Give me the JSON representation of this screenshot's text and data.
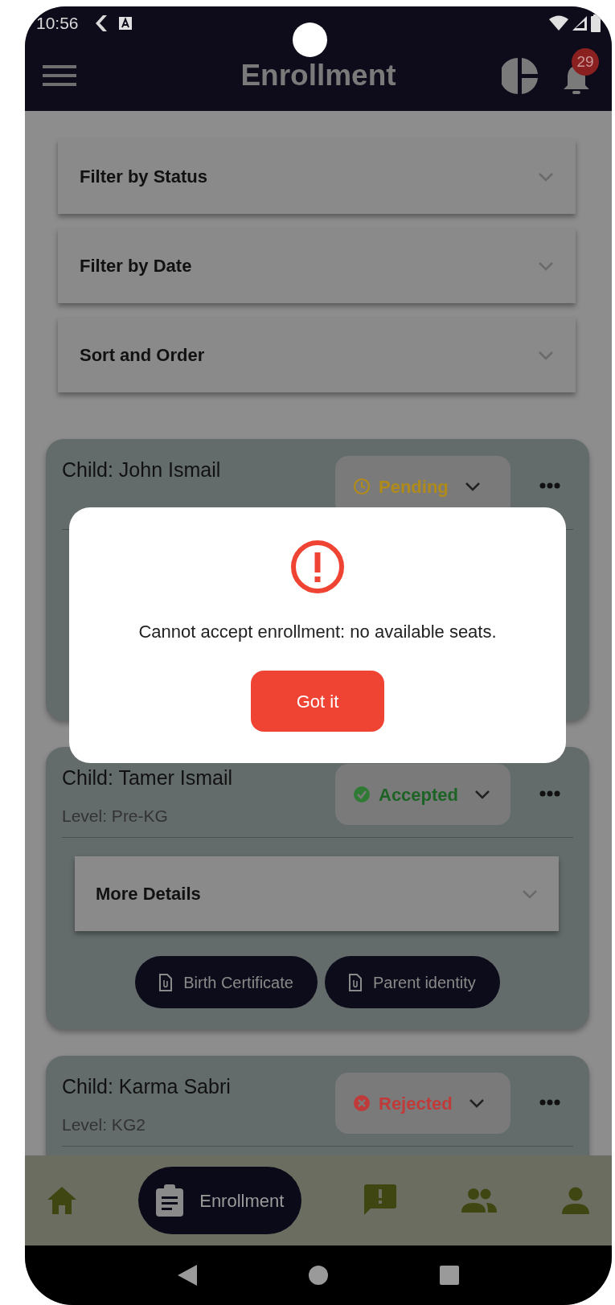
{
  "status_bar": {
    "time": "10:56"
  },
  "app_bar": {
    "title": "Enrollment",
    "notification_count": "29"
  },
  "filters": [
    {
      "label": "Filter by Status"
    },
    {
      "label": "Filter by Date"
    },
    {
      "label": "Sort and Order"
    }
  ],
  "enrollments": [
    {
      "child": "Child: John Ismail",
      "status": {
        "kind": "pending",
        "label": "Pending"
      }
    },
    {
      "child": "Child: Tamer Ismail",
      "level": "Level: Pre-KG",
      "status": {
        "kind": "accepted",
        "label": "Accepted"
      },
      "details": {
        "label": "More Details"
      },
      "documents": [
        "Birth Certificate",
        "Parent identity"
      ]
    },
    {
      "child": "Child: Karma Sabri",
      "level": "Level: KG2",
      "status": {
        "kind": "rejected",
        "label": "Rejected"
      }
    }
  ],
  "dialog": {
    "message": "Cannot accept enrollment: no available seats.",
    "button": "Got it"
  },
  "bottom_nav": [
    {
      "kind": "home",
      "selected": false
    },
    {
      "kind": "enrollment",
      "label": "Enrollment",
      "selected": true
    },
    {
      "kind": "report",
      "selected": false
    },
    {
      "kind": "people",
      "selected": false
    },
    {
      "kind": "profile",
      "selected": false
    }
  ]
}
